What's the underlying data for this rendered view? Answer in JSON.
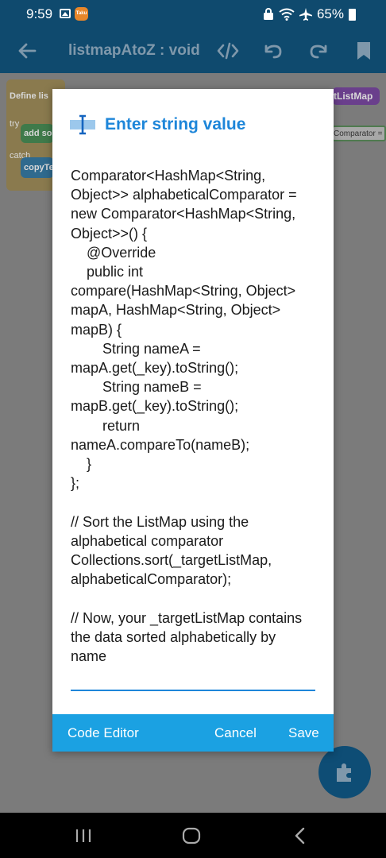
{
  "status_bar": {
    "time": "9:59",
    "app_badge": "Taku",
    "battery": "65%"
  },
  "toolbar": {
    "title": "listmapAtoZ : void"
  },
  "background_blocks": {
    "define_label": "Define lis",
    "try_label": "try",
    "add_label": "add so",
    "catch_label": "catch",
    "copy_label": "copyTe",
    "target_label": "tListMap",
    "comparator_label": "Comparator ="
  },
  "dialog": {
    "title": "Enter string value",
    "value": "Comparator<HashMap<String, Object>> alphabeticalComparator = new Comparator<HashMap<String, Object>>() {\n    @Override\n    public int compare(HashMap<String, Object> mapA, HashMap<String, Object> mapB) {\n        String nameA = mapA.get(_key).toString();\n        String nameB = mapB.get(_key).toString();\n        return nameA.compareTo(nameB);\n    }\n};\n\n// Sort the ListMap using the alphabetical comparator\nCollections.sort(_targetListMap, alphabeticalComparator);\n\n// Now, your _targetListMap contains the data sorted alphabetically by name",
    "code_editor_label": "Code Editor",
    "cancel_label": "Cancel",
    "save_label": "Save"
  },
  "colors": {
    "accent": "#1e86d9",
    "action_bar": "#1ba1e2",
    "toolbar": "#0f4a6e"
  }
}
